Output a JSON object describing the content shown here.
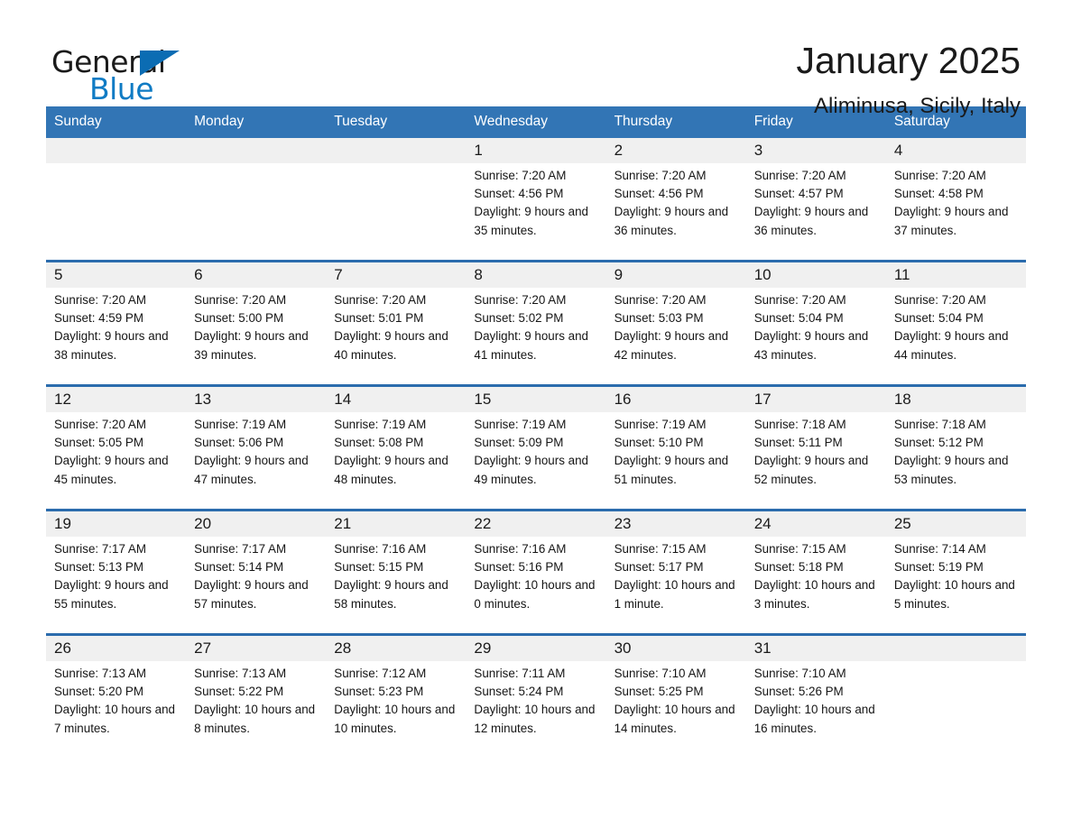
{
  "brand": {
    "word1": "General",
    "word2": "Blue",
    "triangle_color": "#0b6cb3",
    "blue_text_color": "#0f7bc4",
    "logo_icon": "triangle-flag-icon"
  },
  "header": {
    "title": "January 2025",
    "subtitle": "Aliminusa, Sicily, Italy"
  },
  "colors": {
    "header_bg": "#3275b5",
    "header_text": "#ffffff",
    "week_rule": "#2b6cad",
    "daynum_bg": "#f0f0f0",
    "body_bg": "#ffffff",
    "text": "#151515"
  },
  "calendar": {
    "day_names": [
      "Sunday",
      "Monday",
      "Tuesday",
      "Wednesday",
      "Thursday",
      "Friday",
      "Saturday"
    ],
    "labels": {
      "sunrise": "Sunrise:",
      "sunset": "Sunset:",
      "daylight": "Daylight:"
    },
    "weeks": [
      [
        {
          "day": "",
          "lines": ""
        },
        {
          "day": "",
          "lines": ""
        },
        {
          "day": "",
          "lines": ""
        },
        {
          "day": "1",
          "lines": "Sunrise: 7:20 AM\nSunset: 4:56 PM\nDaylight: 9 hours\nand 35 minutes."
        },
        {
          "day": "2",
          "lines": "Sunrise: 7:20 AM\nSunset: 4:56 PM\nDaylight: 9 hours\nand 36 minutes."
        },
        {
          "day": "3",
          "lines": "Sunrise: 7:20 AM\nSunset: 4:57 PM\nDaylight: 9 hours\nand 36 minutes."
        },
        {
          "day": "4",
          "lines": "Sunrise: 7:20 AM\nSunset: 4:58 PM\nDaylight: 9 hours\nand 37 minutes."
        }
      ],
      [
        {
          "day": "5",
          "lines": "Sunrise: 7:20 AM\nSunset: 4:59 PM\nDaylight: 9 hours\nand 38 minutes."
        },
        {
          "day": "6",
          "lines": "Sunrise: 7:20 AM\nSunset: 5:00 PM\nDaylight: 9 hours\nand 39 minutes."
        },
        {
          "day": "7",
          "lines": "Sunrise: 7:20 AM\nSunset: 5:01 PM\nDaylight: 9 hours\nand 40 minutes."
        },
        {
          "day": "8",
          "lines": "Sunrise: 7:20 AM\nSunset: 5:02 PM\nDaylight: 9 hours\nand 41 minutes."
        },
        {
          "day": "9",
          "lines": "Sunrise: 7:20 AM\nSunset: 5:03 PM\nDaylight: 9 hours\nand 42 minutes."
        },
        {
          "day": "10",
          "lines": "Sunrise: 7:20 AM\nSunset: 5:04 PM\nDaylight: 9 hours\nand 43 minutes."
        },
        {
          "day": "11",
          "lines": "Sunrise: 7:20 AM\nSunset: 5:04 PM\nDaylight: 9 hours\nand 44 minutes."
        }
      ],
      [
        {
          "day": "12",
          "lines": "Sunrise: 7:20 AM\nSunset: 5:05 PM\nDaylight: 9 hours\nand 45 minutes."
        },
        {
          "day": "13",
          "lines": "Sunrise: 7:19 AM\nSunset: 5:06 PM\nDaylight: 9 hours\nand 47 minutes."
        },
        {
          "day": "14",
          "lines": "Sunrise: 7:19 AM\nSunset: 5:08 PM\nDaylight: 9 hours\nand 48 minutes."
        },
        {
          "day": "15",
          "lines": "Sunrise: 7:19 AM\nSunset: 5:09 PM\nDaylight: 9 hours\nand 49 minutes."
        },
        {
          "day": "16",
          "lines": "Sunrise: 7:19 AM\nSunset: 5:10 PM\nDaylight: 9 hours\nand 51 minutes."
        },
        {
          "day": "17",
          "lines": "Sunrise: 7:18 AM\nSunset: 5:11 PM\nDaylight: 9 hours\nand 52 minutes."
        },
        {
          "day": "18",
          "lines": "Sunrise: 7:18 AM\nSunset: 5:12 PM\nDaylight: 9 hours\nand 53 minutes."
        }
      ],
      [
        {
          "day": "19",
          "lines": "Sunrise: 7:17 AM\nSunset: 5:13 PM\nDaylight: 9 hours\nand 55 minutes."
        },
        {
          "day": "20",
          "lines": "Sunrise: 7:17 AM\nSunset: 5:14 PM\nDaylight: 9 hours\nand 57 minutes."
        },
        {
          "day": "21",
          "lines": "Sunrise: 7:16 AM\nSunset: 5:15 PM\nDaylight: 9 hours\nand 58 minutes."
        },
        {
          "day": "22",
          "lines": "Sunrise: 7:16 AM\nSunset: 5:16 PM\nDaylight: 10 hours\nand 0 minutes."
        },
        {
          "day": "23",
          "lines": "Sunrise: 7:15 AM\nSunset: 5:17 PM\nDaylight: 10 hours\nand 1 minute."
        },
        {
          "day": "24",
          "lines": "Sunrise: 7:15 AM\nSunset: 5:18 PM\nDaylight: 10 hours\nand 3 minutes."
        },
        {
          "day": "25",
          "lines": "Sunrise: 7:14 AM\nSunset: 5:19 PM\nDaylight: 10 hours\nand 5 minutes."
        }
      ],
      [
        {
          "day": "26",
          "lines": "Sunrise: 7:13 AM\nSunset: 5:20 PM\nDaylight: 10 hours\nand 7 minutes."
        },
        {
          "day": "27",
          "lines": "Sunrise: 7:13 AM\nSunset: 5:22 PM\nDaylight: 10 hours\nand 8 minutes."
        },
        {
          "day": "28",
          "lines": "Sunrise: 7:12 AM\nSunset: 5:23 PM\nDaylight: 10 hours\nand 10 minutes."
        },
        {
          "day": "29",
          "lines": "Sunrise: 7:11 AM\nSunset: 5:24 PM\nDaylight: 10 hours\nand 12 minutes."
        },
        {
          "day": "30",
          "lines": "Sunrise: 7:10 AM\nSunset: 5:25 PM\nDaylight: 10 hours\nand 14 minutes."
        },
        {
          "day": "31",
          "lines": "Sunrise: 7:10 AM\nSunset: 5:26 PM\nDaylight: 10 hours\nand 16 minutes."
        },
        {
          "day": "",
          "lines": ""
        }
      ]
    ]
  }
}
